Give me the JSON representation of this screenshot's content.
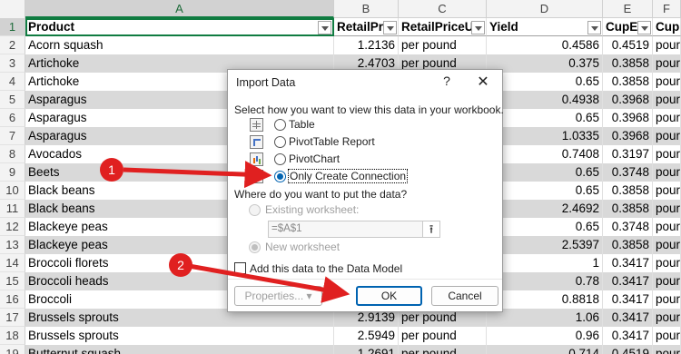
{
  "sheet": {
    "columns": [
      {
        "letter": "A",
        "header": "Product"
      },
      {
        "letter": "B",
        "header": "RetailPr"
      },
      {
        "letter": "C",
        "header": "RetailPriceU"
      },
      {
        "letter": "D",
        "header": "Yield"
      },
      {
        "letter": "E",
        "header": "CupE"
      },
      {
        "letter": "F",
        "header": "Cup"
      }
    ],
    "header_row_number": "1",
    "rows": [
      {
        "num": "2",
        "product": "Acorn squash",
        "retail": "1.2136",
        "unit": "per pound",
        "yield": "0.4586",
        "cup": "0.4519",
        "cupu": "pour"
      },
      {
        "num": "3",
        "product": "Artichoke",
        "retail": "2.4703",
        "unit": "per pound",
        "yield": "0.375",
        "cup": "0.3858",
        "cupu": "pour"
      },
      {
        "num": "4",
        "product": "Artichoke",
        "retail": "",
        "unit": "",
        "yield": "0.65",
        "cup": "0.3858",
        "cupu": "pour"
      },
      {
        "num": "5",
        "product": "Asparagus",
        "retail": "",
        "unit": "",
        "yield": "0.4938",
        "cup": "0.3968",
        "cupu": "pour"
      },
      {
        "num": "6",
        "product": "Asparagus",
        "retail": "",
        "unit": "",
        "yield": "0.65",
        "cup": "0.3968",
        "cupu": "pour"
      },
      {
        "num": "7",
        "product": "Asparagus",
        "retail": "",
        "unit": "",
        "yield": "1.0335",
        "cup": "0.3968",
        "cupu": "pour"
      },
      {
        "num": "8",
        "product": "Avocados",
        "retail": "",
        "unit": "",
        "yield": "0.7408",
        "cup": "0.3197",
        "cupu": "pour"
      },
      {
        "num": "9",
        "product": "Beets",
        "retail": "",
        "unit": "",
        "yield": "0.65",
        "cup": "0.3748",
        "cupu": "pour"
      },
      {
        "num": "10",
        "product": "Black beans",
        "retail": "",
        "unit": "",
        "yield": "0.65",
        "cup": "0.3858",
        "cupu": "pour"
      },
      {
        "num": "11",
        "product": "Black beans",
        "retail": "",
        "unit": "",
        "yield": "2.4692",
        "cup": "0.3858",
        "cupu": "pour"
      },
      {
        "num": "12",
        "product": "Blackeye peas",
        "retail": "",
        "unit": "",
        "yield": "0.65",
        "cup": "0.3748",
        "cupu": "pour"
      },
      {
        "num": "13",
        "product": "Blackeye peas",
        "retail": "",
        "unit": "",
        "yield": "2.5397",
        "cup": "0.3858",
        "cupu": "pour"
      },
      {
        "num": "14",
        "product": "Broccoli florets",
        "retail": "",
        "unit": "",
        "yield": "1",
        "cup": "0.3417",
        "cupu": "pour"
      },
      {
        "num": "15",
        "product": "Broccoli heads",
        "retail": "",
        "unit": "",
        "yield": "0.78",
        "cup": "0.3417",
        "cupu": "pour"
      },
      {
        "num": "16",
        "product": "Broccoli",
        "retail": "",
        "unit": "",
        "yield": "0.8818",
        "cup": "0.3417",
        "cupu": "pour"
      },
      {
        "num": "17",
        "product": "Brussels sprouts",
        "retail": "2.9139",
        "unit": "per pound",
        "yield": "1.06",
        "cup": "0.3417",
        "cupu": "pour"
      },
      {
        "num": "18",
        "product": "Brussels sprouts",
        "retail": "2.5949",
        "unit": "per pound",
        "yield": "0.96",
        "cup": "0.3417",
        "cupu": "pour"
      },
      {
        "num": "19",
        "product": "Butternut squash",
        "retail": "1.2691",
        "unit": "per pound",
        "yield": "0.714",
        "cup": "0.4519",
        "cupu": "pour"
      }
    ]
  },
  "dialog": {
    "title": "Import Data",
    "help": "?",
    "close": "✕",
    "prompt_view": "Select how you want to view this data in your workbook.",
    "options": [
      {
        "label": "Table",
        "icon": "table-icon"
      },
      {
        "label": "PivotTable Report",
        "icon": "pivottable-icon"
      },
      {
        "label": "PivotChart",
        "icon": "pivotchart-icon"
      },
      {
        "label": "Only Create Connection",
        "icon": "connection-icon",
        "selected": true
      }
    ],
    "prompt_put": "Where do you want to put the data?",
    "existing_label": "Existing worksheet:",
    "ref_value": "=$A$1",
    "ref_button": "⭱",
    "new_label": "New worksheet",
    "datamodel_label": "Add this data to the Data Model",
    "properties_label": "Properties...",
    "ok_label": "OK",
    "cancel_label": "Cancel"
  },
  "annotations": {
    "step1": "1",
    "step2": "2",
    "color": "#e02020"
  }
}
